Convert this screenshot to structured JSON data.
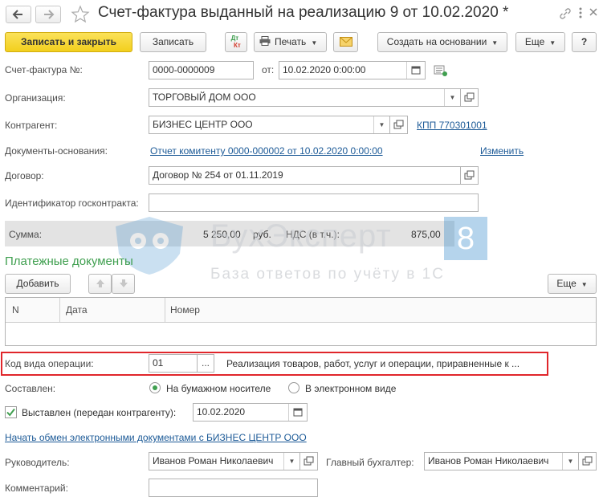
{
  "header": {
    "title": "Счет-фактура выданный на реализацию 9 от 10.02.2020 *"
  },
  "toolbar": {
    "save_close": "Записать и закрыть",
    "save": "Записать",
    "dt_kt_top": "Дт",
    "dt_kt_bottom": "Кт",
    "print": "Печать",
    "create_based": "Создать на основании",
    "more": "Еще",
    "help": "?"
  },
  "form": {
    "invoice_label": "Счет-фактура №:",
    "invoice_number": "0000-0000009",
    "date_from_label": "от:",
    "invoice_date": "10.02.2020  0:00:00",
    "org_label": "Организация:",
    "org_value": "ТОРГОВЫЙ ДОМ ООО",
    "contractor_label": "Контрагент:",
    "contractor_value": "БИЗНЕС ЦЕНТР ООО",
    "kpp_link": "КПП 770301001",
    "base_docs_label": "Документы-основания:",
    "base_docs_link": "Отчет комитенту 0000-000002 от 10.02.2020 0:00:00",
    "change_link": "Изменить",
    "contract_label": "Договор:",
    "contract_value": "Договор № 254 от 01.11.2019",
    "gov_contract_label": "Идентификатор госконтракта:",
    "gov_contract_value": ""
  },
  "sum": {
    "label": "Сумма:",
    "amount": "5 250,00",
    "currency": "руб.",
    "vat_label": "НДС (в т.ч.):",
    "vat_amount": "875,00"
  },
  "watermark": {
    "brand": "БухЭксперт",
    "badge": "8",
    "tagline": "База ответов по учёту в 1С"
  },
  "payments": {
    "title": "Платежные документы",
    "add_button": "Добавить",
    "more_button": "Еще",
    "columns": [
      "N",
      "Дата",
      "Номер"
    ],
    "rows": []
  },
  "operation": {
    "label": "Код вида операции:",
    "code": "01",
    "ellipsis": "...",
    "description": "Реализация товаров, работ, услуг и операции, приравненные к ..."
  },
  "composed": {
    "label": "Составлен:",
    "option_paper": "На бумажном носителе",
    "option_electronic": "В электронном виде",
    "selected": "На бумажном носителе"
  },
  "issued": {
    "label": "Выставлен (передан контрагенту):",
    "checked": true,
    "date": "10.02.2020"
  },
  "edo_link": "Начать обмен электронными документами с БИЗНЕС ЦЕНТР ООО",
  "signers": {
    "head_label": "Руководитель:",
    "head_value": "Иванов Роман Николаевич",
    "accountant_label": "Главный бухгалтер:",
    "accountant_value": "Иванов Роман Николаевич"
  },
  "comment": {
    "label": "Комментарий:",
    "value": ""
  },
  "colors": {
    "accent_yellow": "#f5d428",
    "title_green": "#3f9f4f",
    "link_blue": "#1c5a97",
    "highlight_red": "#e0262b",
    "sum_band": "#e3e3e3",
    "watermark_badge": "#2f86c9"
  }
}
